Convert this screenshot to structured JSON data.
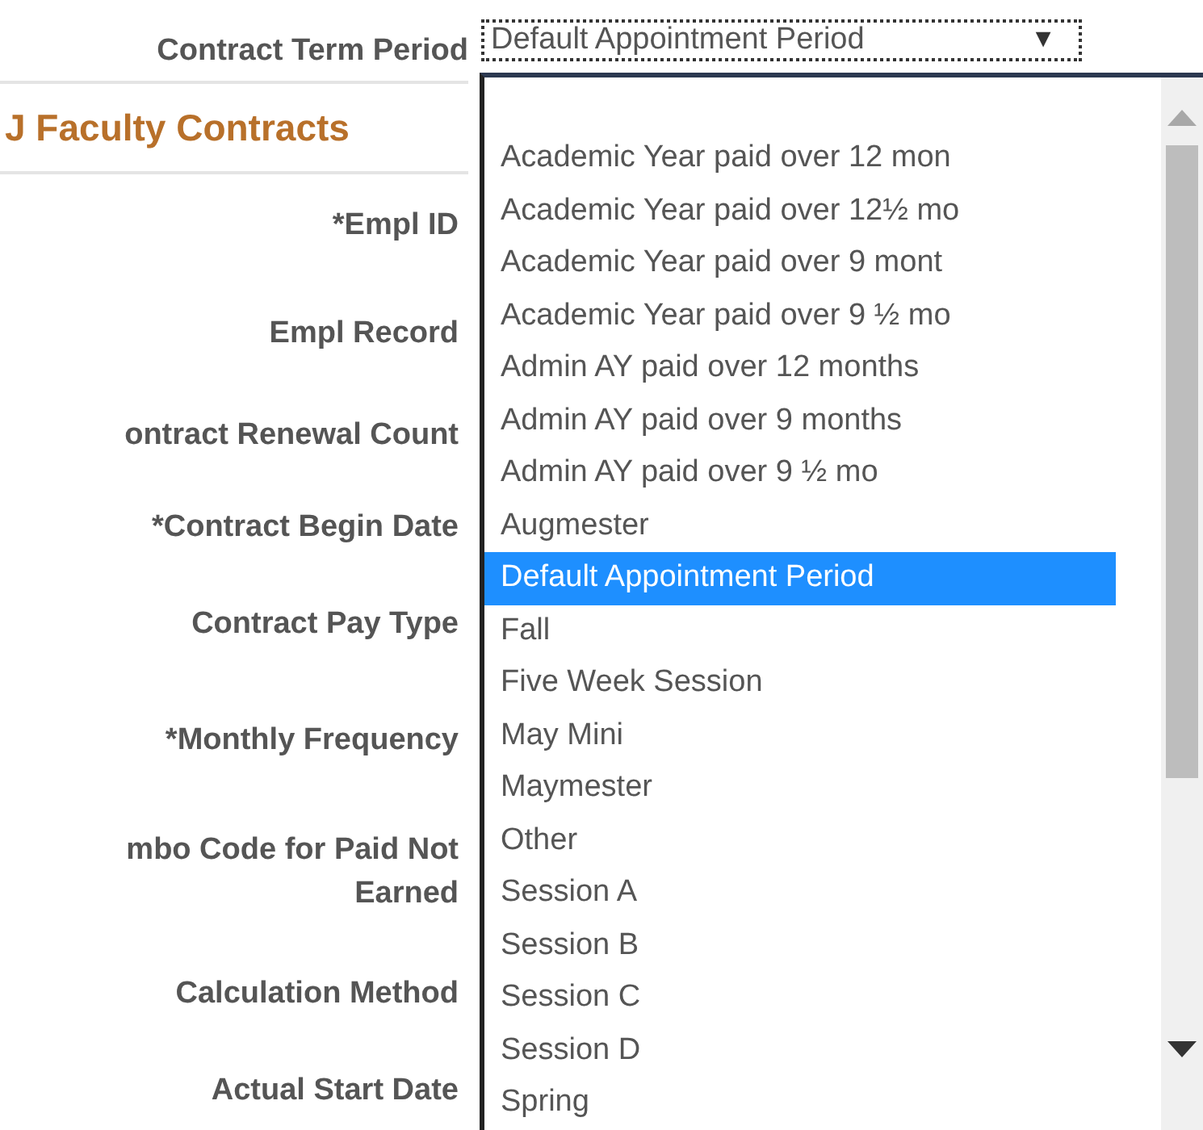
{
  "field": {
    "label": "Contract Term Period",
    "value": "Default Appointment Period",
    "arrow": "▼"
  },
  "section_title": "J Faculty Contracts",
  "labels": [
    {
      "text": "*Empl ID"
    },
    {
      "text": "Empl Record"
    },
    {
      "text": "ontract Renewal Count"
    },
    {
      "text": "*Contract Begin Date"
    },
    {
      "text": "Contract Pay Type"
    },
    {
      "text": "*Monthly Frequency"
    },
    {
      "text": "mbo Code for Paid Not Earned"
    },
    {
      "text": "Calculation Method"
    },
    {
      "text": "Actual Start Date"
    }
  ],
  "dropdown": {
    "options": [
      {
        "label": "Academic Year paid over 12 mon",
        "selected": false
      },
      {
        "label": "Academic Year paid over 12½ mo",
        "selected": false
      },
      {
        "label": "Academic Year paid over 9 mont",
        "selected": false
      },
      {
        "label": "Academic Year paid over 9 ½ mo",
        "selected": false
      },
      {
        "label": "Admin AY paid over 12 months",
        "selected": false
      },
      {
        "label": "Admin AY paid over 9 months",
        "selected": false
      },
      {
        "label": "Admin AY paid over 9 ½ mo",
        "selected": false
      },
      {
        "label": "Augmester",
        "selected": false
      },
      {
        "label": "Default Appointment Period",
        "selected": true
      },
      {
        "label": "Fall",
        "selected": false
      },
      {
        "label": "Five Week Session",
        "selected": false
      },
      {
        "label": "May Mini",
        "selected": false
      },
      {
        "label": "Maymester",
        "selected": false
      },
      {
        "label": "Other",
        "selected": false
      },
      {
        "label": "Session A",
        "selected": false
      },
      {
        "label": "Session B",
        "selected": false
      },
      {
        "label": "Session C",
        "selected": false
      },
      {
        "label": "Session D",
        "selected": false
      },
      {
        "label": "Spring",
        "selected": false
      }
    ]
  }
}
